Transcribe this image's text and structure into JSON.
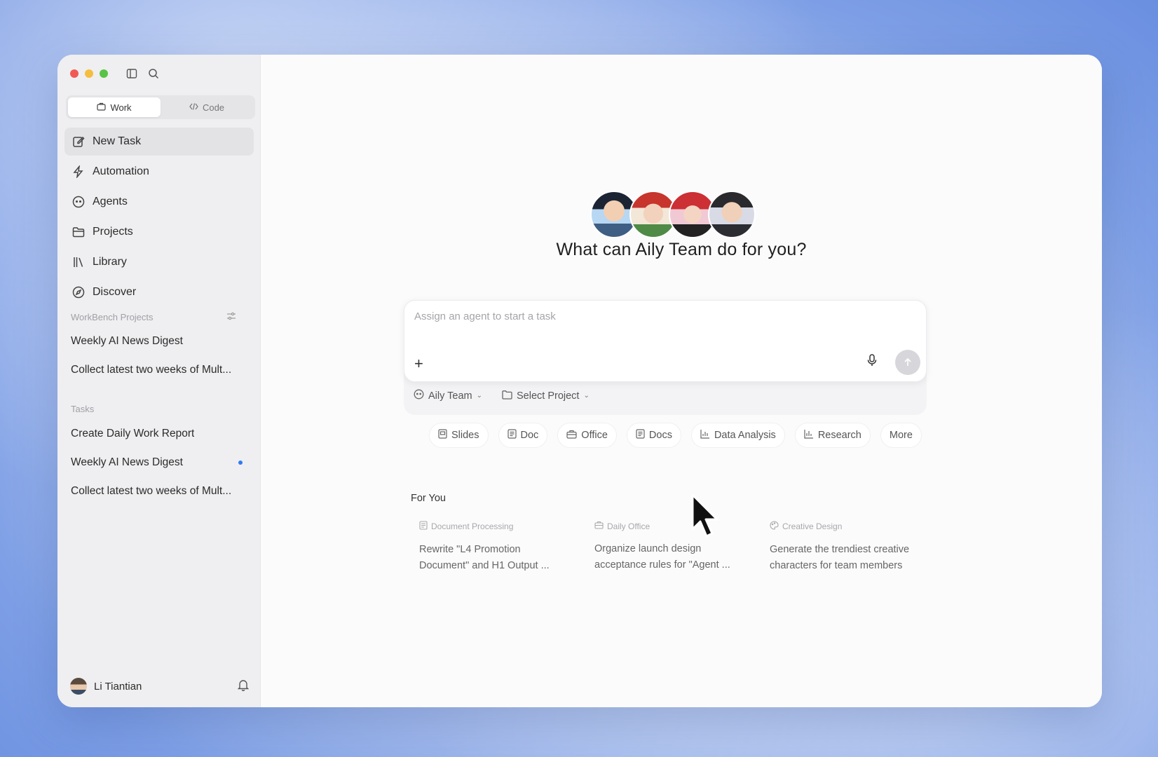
{
  "sidebar": {
    "segments": [
      "Work",
      "Code"
    ],
    "nav": [
      {
        "label": "New Task",
        "icon": "edit-icon"
      },
      {
        "label": "Automation",
        "icon": "lightning-icon"
      },
      {
        "label": "Agents",
        "icon": "agent-icon"
      },
      {
        "label": "Projects",
        "icon": "folder-icon"
      },
      {
        "label": "Library",
        "icon": "library-icon"
      },
      {
        "label": "Discover",
        "icon": "compass-icon"
      }
    ],
    "workbench_title": "WorkBench Projects",
    "workbench_items": [
      "Weekly AI News Digest",
      "Collect latest two weeks of Mult..."
    ],
    "tasks_title": "Tasks",
    "task_items": [
      "Create Daily Work Report",
      "Weekly AI News Digest",
      "Collect latest two weeks of Mult..."
    ],
    "user_name": "Li Tiantian"
  },
  "main": {
    "headline": "What can Aily Team do for you?",
    "input_placeholder": "Assign an agent to start a task",
    "team_selector": "Aily Team",
    "project_selector": "Select Project",
    "chips": [
      "Slides",
      "Doc",
      "Office",
      "Docs",
      "Data Analysis",
      "Research",
      "More"
    ],
    "for_you_title": "For You",
    "cards": [
      {
        "category": "Document Processing",
        "text": "Rewrite \"L4 Promotion Document\" and H1 Output ..."
      },
      {
        "category": "Daily Office",
        "text": "Organize launch design acceptance rules for \"Agent ..."
      },
      {
        "category": "Creative Design",
        "text": "Generate the trendiest creative characters for team members"
      }
    ]
  },
  "colors": {
    "accent": "#2f7bf5",
    "unread_dot": "#2f7bf5"
  }
}
